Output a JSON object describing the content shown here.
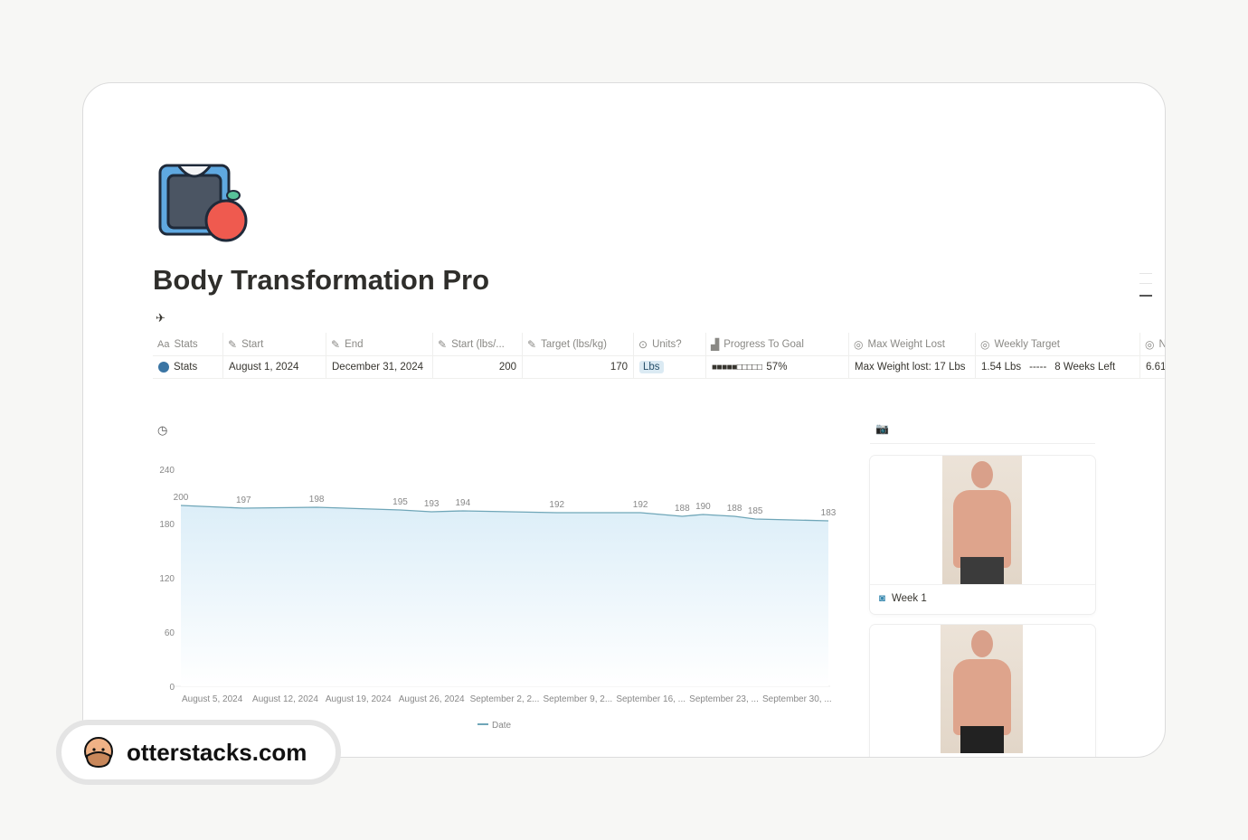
{
  "page": {
    "title": "Body Transformation Pro",
    "icon": "scale-apple-icon"
  },
  "table": {
    "columns": [
      {
        "label": "Stats",
        "icon": "Aa"
      },
      {
        "label": "Start",
        "icon": "pencil-icon"
      },
      {
        "label": "End",
        "icon": "pencil-icon"
      },
      {
        "label": "Start (lbs/...",
        "icon": "pencil-icon"
      },
      {
        "label": "Target (lbs/kg)",
        "icon": "pencil-icon"
      },
      {
        "label": "Units?",
        "icon": "select-icon"
      },
      {
        "label": "Progress To Goal",
        "icon": "bar-icon"
      },
      {
        "label": "Max Weight Lost",
        "icon": "target-icon"
      },
      {
        "label": "Weekly Target",
        "icon": "target-arrow-icon"
      },
      {
        "label": "N",
        "icon": "target-arrow-icon"
      }
    ],
    "row": {
      "stats": "Stats",
      "start": "August 1, 2024",
      "end": "December 31, 2024",
      "start_weight": "200",
      "target_weight": "170",
      "units": "Lbs",
      "progress_bar": "■■■■■□□□□□",
      "progress": "57%",
      "progress_value": 57,
      "max_lost": "Max Weight lost: 17 Lbs",
      "weekly_target": "1.54 Lbs",
      "weekly_sep": "-----",
      "weeks_left": "8 Weeks Left",
      "next": "6.61"
    },
    "colors": {
      "stats_dot": "#3b75a4",
      "units_tag": "#dbeaf3"
    }
  },
  "chart_data": {
    "type": "area",
    "title": "",
    "xlabel": "",
    "ylabel": "",
    "ylim": [
      0,
      240
    ],
    "yticks": [
      "0",
      "60",
      "120",
      "180",
      "240"
    ],
    "x": [
      "2024-08-02",
      "2024-08-08",
      "2024-08-15",
      "2024-08-23",
      "2024-08-26",
      "2024-08-29",
      "2024-09-07",
      "2024-09-15",
      "2024-09-19",
      "2024-09-21",
      "2024-09-24",
      "2024-09-26",
      "2024-10-03"
    ],
    "xticks": [
      "August 5, 2024",
      "August 12, 2024",
      "August 19, 2024",
      "August 26, 2024",
      "September 2, 2...",
      "September 9, 2...",
      "September 16, ...",
      "September 23, ...",
      "September 30, ..."
    ],
    "xtick_dates": [
      "2024-08-05",
      "2024-08-12",
      "2024-08-19",
      "2024-08-26",
      "2024-09-02",
      "2024-09-09",
      "2024-09-16",
      "2024-09-23",
      "2024-09-30"
    ],
    "series": [
      {
        "name": "Date",
        "values": [
          200,
          197,
          198,
          195,
          193,
          194,
          192,
          192,
          188,
          190,
          188,
          185,
          183
        ]
      }
    ],
    "legend": "bottom",
    "grid": false,
    "color": "#6fa6b8"
  },
  "gallery": {
    "icon": "camera-icon",
    "items": [
      {
        "caption": "Week 1"
      },
      {
        "caption": ""
      }
    ]
  },
  "watermark": {
    "text": "otterstacks.com"
  }
}
